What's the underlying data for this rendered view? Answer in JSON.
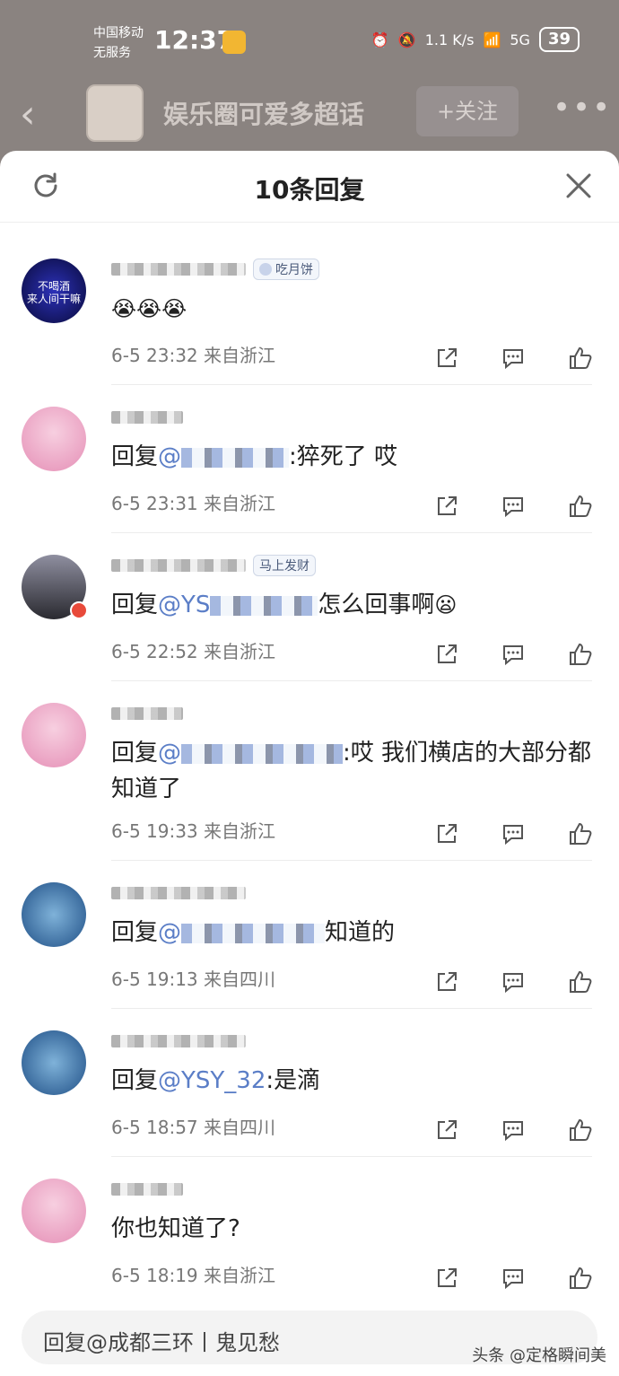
{
  "status": {
    "carrier_line1": "中国移动",
    "carrier_line2": "无服务",
    "time": "12:37",
    "net_speed": "1.1 K/s",
    "signal": "5G",
    "battery": "39"
  },
  "topbar": {
    "title": "娱乐圈可爱多超话",
    "follow_label": "+关注",
    "more": "•••"
  },
  "sheet": {
    "title": "10条回复"
  },
  "replies": [
    {
      "badge": "吃月饼",
      "prefix": "",
      "mention": "",
      "text": "",
      "emoji": "😭😭😭",
      "date": "6-5 23:32",
      "loc": "来自浙江"
    },
    {
      "badge": "",
      "prefix": "回复",
      "mention": "@",
      "text": ":猝死了 哎",
      "emoji": "",
      "date": "6-5 23:31",
      "loc": "来自浙江"
    },
    {
      "badge": "马上发财",
      "prefix": "回复",
      "mention": "@YS",
      "text": "怎么回事啊",
      "emoji": "😦",
      "date": "6-5 22:52",
      "loc": "来自浙江"
    },
    {
      "badge": "",
      "prefix": "回复",
      "mention": "@",
      "text": ":哎 我们横店的大部分都知道了",
      "emoji": "",
      "date": "6-5 19:33",
      "loc": "来自浙江"
    },
    {
      "badge": "",
      "prefix": "回复",
      "mention": "@",
      "text": "知道的",
      "emoji": "",
      "date": "6-5 19:13",
      "loc": "来自四川"
    },
    {
      "badge": "",
      "prefix": "回复",
      "mention": "@YSY_32",
      "text": ":是滴",
      "emoji": "",
      "date": "6-5 18:57",
      "loc": "来自四川"
    },
    {
      "badge": "",
      "prefix": "",
      "mention": "",
      "text": "你也知道了?",
      "emoji": "",
      "date": "6-5 18:19",
      "loc": "来自浙江"
    }
  ],
  "reply_input": {
    "placeholder": "回复@成都三环丨鬼见愁"
  },
  "watermark": "头条 @定格瞬间美"
}
